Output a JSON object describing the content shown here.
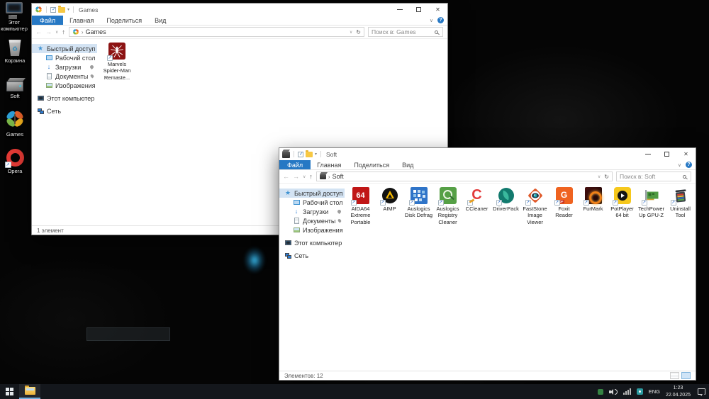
{
  "colors": {
    "accent_blue": "#2678c4",
    "sidebar_selection": "#d3e3f3",
    "taskbar_bg": "#14171c",
    "taskbar_active_underline": "#72aede",
    "desktop_glow": "#39b8e8"
  },
  "desktop": {
    "icons": [
      {
        "label": "Этот компьютер",
        "icon": "computer-icon"
      },
      {
        "label": "Корзина",
        "icon": "recycle-bin-icon"
      },
      {
        "label": "Soft",
        "icon": "drive-icon"
      },
      {
        "label": "Games",
        "icon": "butterfly-icon"
      },
      {
        "label": "Opera",
        "icon": "opera-icon"
      }
    ]
  },
  "games_window": {
    "title": "Games",
    "menu": [
      "Файл",
      "Главная",
      "Поделиться",
      "Вид"
    ],
    "breadcrumb": "Games",
    "search_placeholder": "Поиск в: Games",
    "sidebar": {
      "items": [
        {
          "label": "Быстрый доступ",
          "icon": "star-icon",
          "selected": true
        },
        {
          "label": "Рабочий стол",
          "icon": "desktop-icon",
          "pinned": true
        },
        {
          "label": "Загрузки",
          "icon": "downloads-icon",
          "pinned": true
        },
        {
          "label": "Документы",
          "icon": "documents-icon",
          "pinned": true
        },
        {
          "label": "Изображения",
          "icon": "pictures-icon",
          "pinned": true
        },
        {
          "label": "Этот компьютер",
          "icon": "computer-icon"
        },
        {
          "label": "Сеть",
          "icon": "network-icon"
        }
      ]
    },
    "files": [
      {
        "label": "Marvels Spider-Man Remaste...",
        "icon": "spiderman-icon"
      }
    ],
    "status": "1 элемент"
  },
  "soft_window": {
    "title": "Soft",
    "menu": [
      "Файл",
      "Главная",
      "Поделиться",
      "Вид"
    ],
    "breadcrumb": "Soft",
    "search_placeholder": "Поиск в: Soft",
    "sidebar": {
      "items": [
        {
          "label": "Быстрый доступ",
          "icon": "star-icon",
          "selected": true
        },
        {
          "label": "Рабочий стол",
          "icon": "desktop-icon",
          "pinned": true
        },
        {
          "label": "Загрузки",
          "icon": "downloads-icon",
          "pinned": true
        },
        {
          "label": "Документы",
          "icon": "documents-icon",
          "pinned": true
        },
        {
          "label": "Изображения",
          "icon": "pictures-icon",
          "pinned": true
        },
        {
          "label": "Этот компьютер",
          "icon": "computer-icon"
        },
        {
          "label": "Сеть",
          "icon": "network-icon"
        }
      ]
    },
    "files": [
      {
        "label": "AIDA64 Extreme Portable",
        "icon": "aida64-icon",
        "icon_text": "64"
      },
      {
        "label": "AIMP",
        "icon": "aimp-icon"
      },
      {
        "label": "Auslogics Disk Defrag",
        "icon": "disk-defrag-icon"
      },
      {
        "label": "Auslogics Registry Cleaner",
        "icon": "registry-cleaner-icon"
      },
      {
        "label": "CCleaner",
        "icon": "ccleaner-icon",
        "icon_text": "C"
      },
      {
        "label": "DriverPack",
        "icon": "driverpack-icon"
      },
      {
        "label": "FastStone Image Viewer",
        "icon": "faststone-icon"
      },
      {
        "label": "Foxit Reader",
        "icon": "foxit-icon",
        "icon_text": "G",
        "icon_badge": "PDF"
      },
      {
        "label": "FurMark",
        "icon": "furmark-icon"
      },
      {
        "label": "PotPlayer 64 bit",
        "icon": "potplayer-icon"
      },
      {
        "label": "TechPower Up GPU-Z",
        "icon": "gpuz-icon"
      },
      {
        "label": "Uninstall Tool",
        "icon": "uninstall-tool-icon"
      }
    ],
    "status": "Элементов: 12"
  },
  "taskbar": {
    "language": "ENG",
    "time": "1:23",
    "date": "22.04.2025",
    "tray_icons": [
      "hidden-app-icon",
      "volume-icon",
      "network-icon",
      "app-icon",
      "action-center-icon"
    ]
  }
}
